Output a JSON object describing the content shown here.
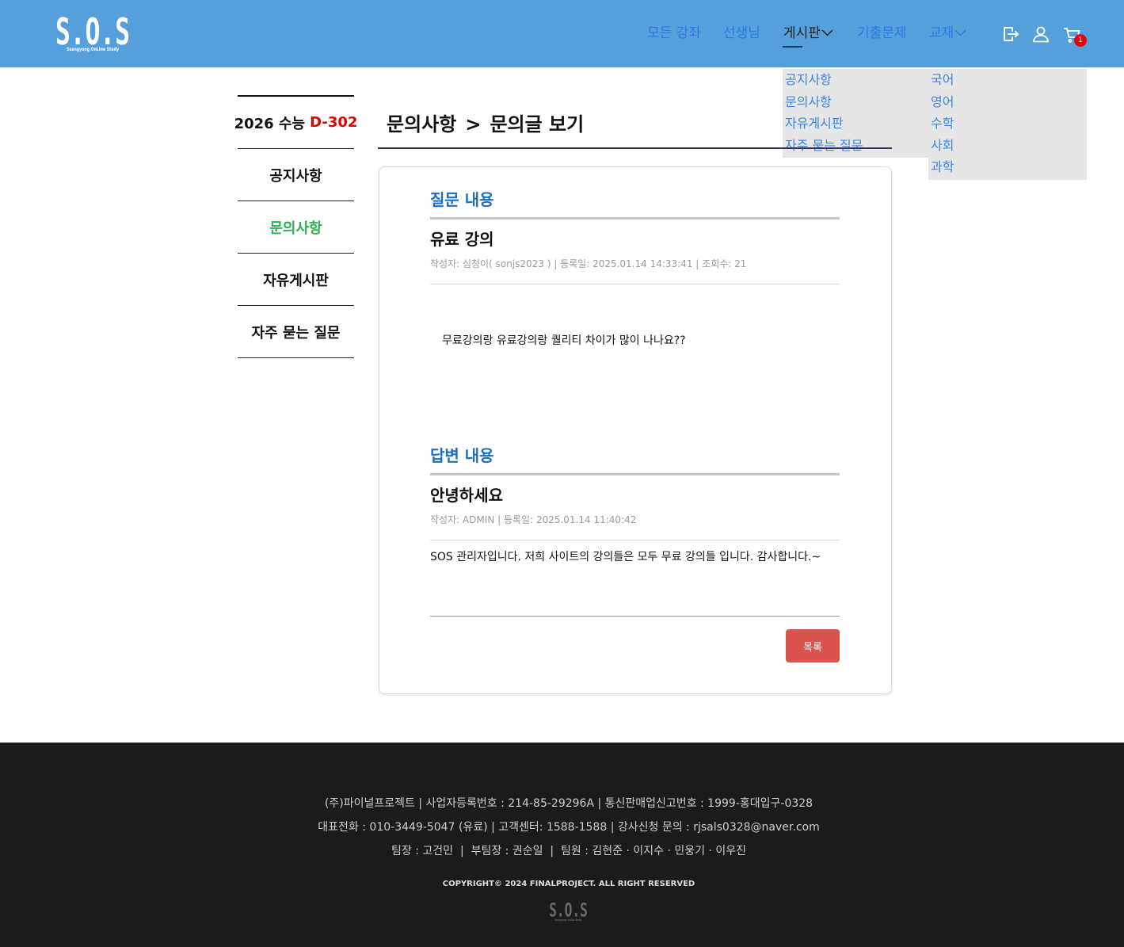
{
  "colors": {
    "header_bg": "#559fdb",
    "nav_link": "#2a7ae2",
    "nav_active": "#222222",
    "dropdown_link": "#3b84e4",
    "cart_badge": "#e8000b",
    "dday_red": "#e00000",
    "sidebar_active": "#2bb24c",
    "section_title": "#1a6fc4",
    "button_bg": "#d9534f",
    "footer_bg": "#1b1b1b"
  },
  "header": {
    "logo": {
      "text": "S.O.S",
      "tagline": "Ssangyong OnLine Study"
    },
    "nav": [
      {
        "label": "모든 강좌"
      },
      {
        "label": "선생님"
      },
      {
        "label": "게시판",
        "dropdown": true,
        "active": true
      },
      {
        "label": "기출문제"
      },
      {
        "label": "교재",
        "dropdown": true
      }
    ],
    "icons": {
      "logout": "logout-icon",
      "user": "user-icon",
      "cart": "cart-icon",
      "chevron": "chevron-down-icon"
    },
    "cart_count": "1"
  },
  "dropdowns": {
    "board": [
      {
        "label": "공지사항"
      },
      {
        "label": "문의사항"
      },
      {
        "label": "자유게시판"
      },
      {
        "label": "자주 묻는 질문"
      }
    ],
    "textbook": [
      {
        "label": "국어"
      },
      {
        "label": "영어"
      },
      {
        "label": "수학"
      },
      {
        "label": "사회"
      },
      {
        "label": "과학"
      }
    ]
  },
  "sidebar": {
    "dday": {
      "label": "2026 수능",
      "value": "D-302"
    },
    "items": [
      {
        "label": "공지사항"
      },
      {
        "label": "문의사항",
        "active": true
      },
      {
        "label": "자유게시판"
      },
      {
        "label": "자주 묻는 질문"
      }
    ]
  },
  "page": {
    "breadcrumb": "문의사항",
    "separator": ">",
    "title": "문의글 보기"
  },
  "question": {
    "section_label": "질문 내용",
    "title": "유료 강의",
    "meta": "작성자: 심청이( sonjs2023 ) | 등록일: 2025.01.14 14:33:41 | 조회수: 21",
    "body": "무료강의랑 유료강의랑 퀄리티 차이가 많이 나나요??"
  },
  "answer": {
    "section_label": "답변 내용",
    "title": "안녕하세요",
    "meta": "작성자: ADMIN | 등록일: 2025.01.14 11:40:42",
    "body": "SOS 관리자입니다. 저희 사이트의 강의들은 모두 무료 강의들 입니다. 감사합니다.~"
  },
  "actions": {
    "list_button": "목록"
  },
  "footer": {
    "lines": [
      "(주)파이널프로젝트 | 사업자등록번호 : 214-85-29296A | 통신판매업신고번호 : 1999-홍대입구-0328",
      "대표전화 : 010-3449-5047 (유료) | 고객센터: 1588-1588 | 강사신청 문의 : rjsals0328@naver.com",
      "팀장 : 고건민  |  부팀장 : 권순일  |  팀원 : 김현준 · 이지수 · 민웅기 · 이우진"
    ],
    "copyright": "COPYRIGHT© 2024 FINALPROJECT. ALL RIGHT RESERVED",
    "logo": {
      "text": "S.O.S",
      "tagline": "Ssangyong OnLine Study"
    }
  }
}
